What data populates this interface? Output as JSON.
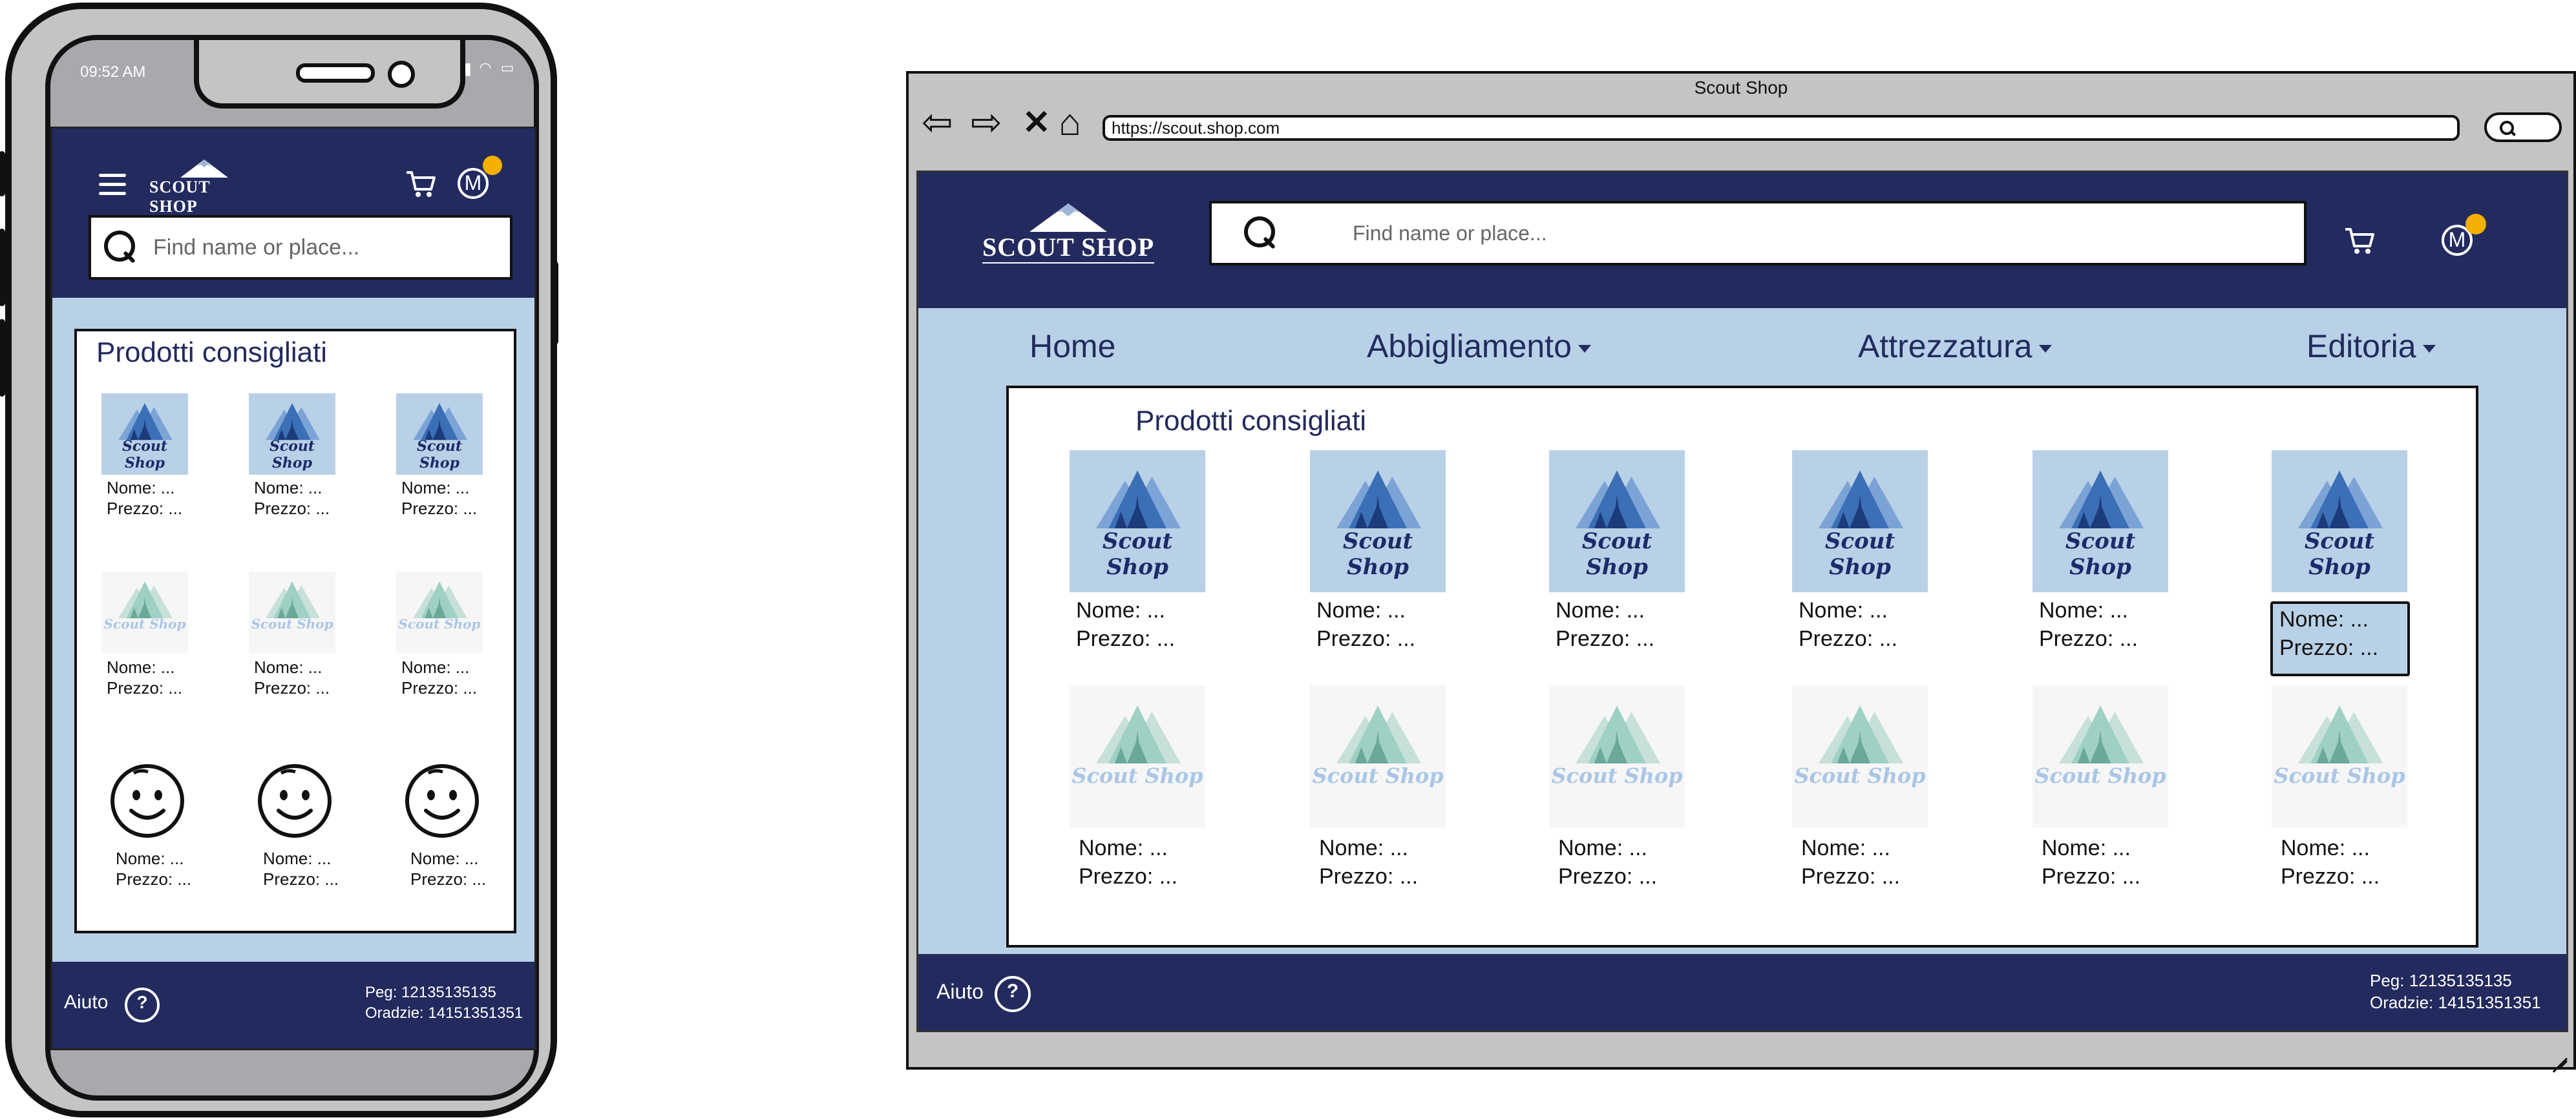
{
  "phone": {
    "status_time": "09:52 AM",
    "logo": "SCOUT SHOP",
    "search_placeholder": "Find name or place...",
    "avatar_letter": "M",
    "section_title": "Prodotti consigliati",
    "product_brand": "Scout Shop",
    "products": [
      {
        "name": "Nome: ...",
        "price": "Prezzo: ..."
      },
      {
        "name": "Nome: ...",
        "price": "Prezzo: ..."
      },
      {
        "name": "Nome: ...",
        "price": "Prezzo: ..."
      },
      {
        "name": "Nome: ...",
        "price": "Prezzo: ..."
      },
      {
        "name": "Nome: ...",
        "price": "Prezzo: ..."
      },
      {
        "name": "Nome: ...",
        "price": "Prezzo: ..."
      },
      {
        "name": "Nome: ...",
        "price": "Prezzo: ..."
      },
      {
        "name": "Nome: ...",
        "price": "Prezzo: ..."
      },
      {
        "name": "Nome: ...",
        "price": "Prezzo: ..."
      }
    ],
    "footer": {
      "help_label": "Aiuto",
      "help_icon": "?",
      "peg": "Peg: 12135135135",
      "oradzie": "Oradzie: 14151351351"
    }
  },
  "browser": {
    "window_title": "Scout Shop",
    "url": "https://scout.shop.com",
    "logo": "SCOUT SHOP",
    "search_placeholder": "Find name or place...",
    "avatar_letter": "M",
    "nav": [
      "Home",
      "Abbigliamento",
      "Attrezzatura",
      "Editoria"
    ],
    "section_title": "Prodotti consigliati",
    "product_brand": "Scout Shop",
    "products": [
      {
        "name": "Nome: ...",
        "price": "Prezzo: ..."
      },
      {
        "name": "Nome: ...",
        "price": "Prezzo: ..."
      },
      {
        "name": "Nome: ...",
        "price": "Prezzo: ..."
      },
      {
        "name": "Nome: ...",
        "price": "Prezzo: ..."
      },
      {
        "name": "Nome: ...",
        "price": "Prezzo: ..."
      },
      {
        "name": "Nome: ...",
        "price": "Prezzo: ..."
      },
      {
        "name": "Nome: ...",
        "price": "Prezzo: ..."
      },
      {
        "name": "Nome: ...",
        "price": "Prezzo: ..."
      },
      {
        "name": "Nome: ...",
        "price": "Prezzo: ..."
      },
      {
        "name": "Nome: ...",
        "price": "Prezzo: ..."
      },
      {
        "name": "Nome: ...",
        "price": "Prezzo: ..."
      },
      {
        "name": "Nome: ...",
        "price": "Prezzo: ..."
      }
    ],
    "footer": {
      "help_label": "Aiuto",
      "help_icon": "?",
      "peg": "Peg: 12135135135",
      "oradzie": "Oradzie: 14151351351"
    }
  },
  "colors": {
    "navy": "#222a5e",
    "light_blue": "#b9d1e7",
    "notification": "#f3b000",
    "frame_gray": "#c4c4c4"
  },
  "icons": [
    "hamburger-icon",
    "cart-icon",
    "avatar-icon",
    "search-icon",
    "help-icon",
    "back-arrow-icon",
    "forward-arrow-icon",
    "close-icon",
    "home-icon",
    "smiley-icon",
    "mountain-logo-icon"
  ]
}
